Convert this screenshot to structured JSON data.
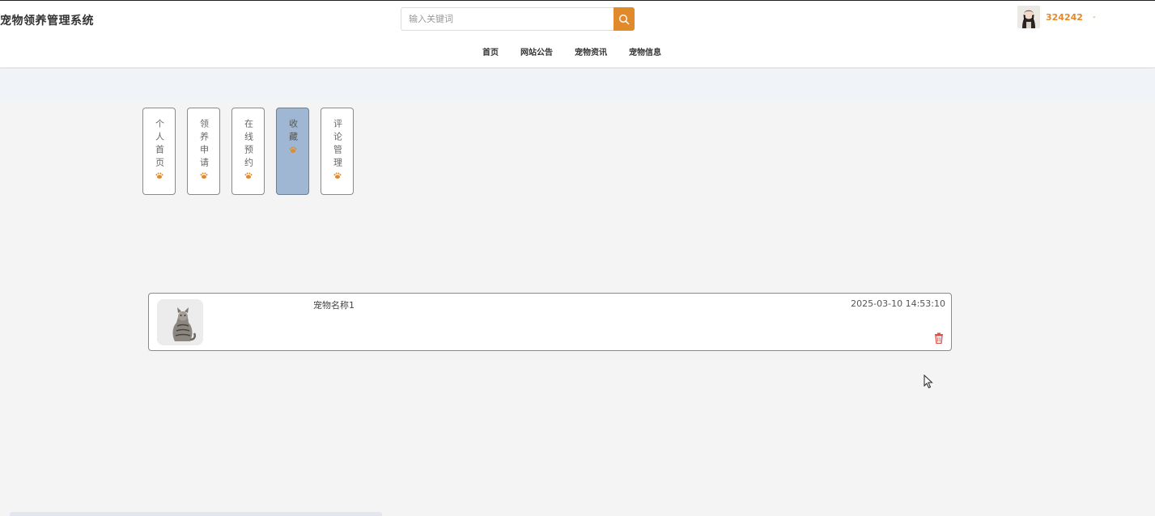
{
  "app": {
    "title": "宠物领养管理系统"
  },
  "search": {
    "placeholder": "输入关键词",
    "icon": "search-icon"
  },
  "user": {
    "name": "324242",
    "caret": "-",
    "avatar": "user-avatar"
  },
  "nav": {
    "items": [
      {
        "label": "首页"
      },
      {
        "label": "网站公告"
      },
      {
        "label": "宠物资讯"
      },
      {
        "label": "宠物信息"
      }
    ]
  },
  "sidebar": {
    "tabs": [
      {
        "label": "个人首页",
        "icon": "paw-icon",
        "active": false
      },
      {
        "label": "领养申请",
        "icon": "paw-icon",
        "active": false
      },
      {
        "label": "在线预约",
        "icon": "paw-icon",
        "active": false
      },
      {
        "label": "收藏",
        "icon": "paw-icon",
        "active": true
      },
      {
        "label": "评论管理",
        "icon": "paw-icon",
        "active": false
      }
    ]
  },
  "favorites": {
    "items": [
      {
        "name": "宠物名称1",
        "time": "2025-03-10 14:53:10",
        "thumbnail": "cat-photo",
        "delete_icon": "trash-icon"
      }
    ]
  },
  "colors": {
    "accent": "#e08a2b",
    "active_tab": "#9fb7d3",
    "delete": "#d9534f",
    "page_bg": "#f4f4f5"
  }
}
